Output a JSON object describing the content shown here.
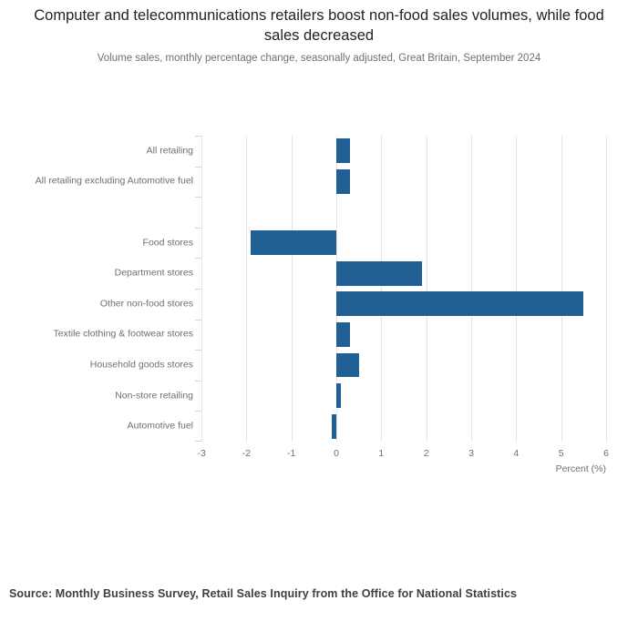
{
  "chart_data": {
    "type": "bar",
    "orientation": "horizontal",
    "title": "Computer and telecommunications retailers boost non-food sales volumes, while food sales decreased",
    "subtitle": "Volume sales, monthly percentage change, seasonally adjusted, Great Britain, September 2024",
    "categories": [
      "All retailing",
      "All retailing excluding Automotive fuel",
      "",
      "Food stores",
      "Department stores",
      "Other non-food stores",
      "Textile clothing & footwear stores",
      "Household goods stores",
      "Non-store retailing",
      "Automotive fuel"
    ],
    "values": [
      0.3,
      0.3,
      null,
      -1.9,
      1.9,
      5.5,
      0.3,
      0.5,
      0.1,
      -0.1
    ],
    "xlabel": "Percent (%)",
    "ylabel": "",
    "xlim": [
      -3,
      6
    ],
    "xticks": [
      -3,
      -2,
      -1,
      0,
      1,
      2,
      3,
      4,
      5,
      6
    ],
    "xtick_labels": [
      "-3",
      "-2",
      "-1",
      "0",
      "1",
      "2",
      "3",
      "4",
      "5",
      "6"
    ],
    "grid": "vertical",
    "legend": "none",
    "bar_color": "#206095"
  },
  "source": {
    "text": "Source: Monthly Business Survey, Retail Sales Inquiry from the Office for National Statistics"
  }
}
